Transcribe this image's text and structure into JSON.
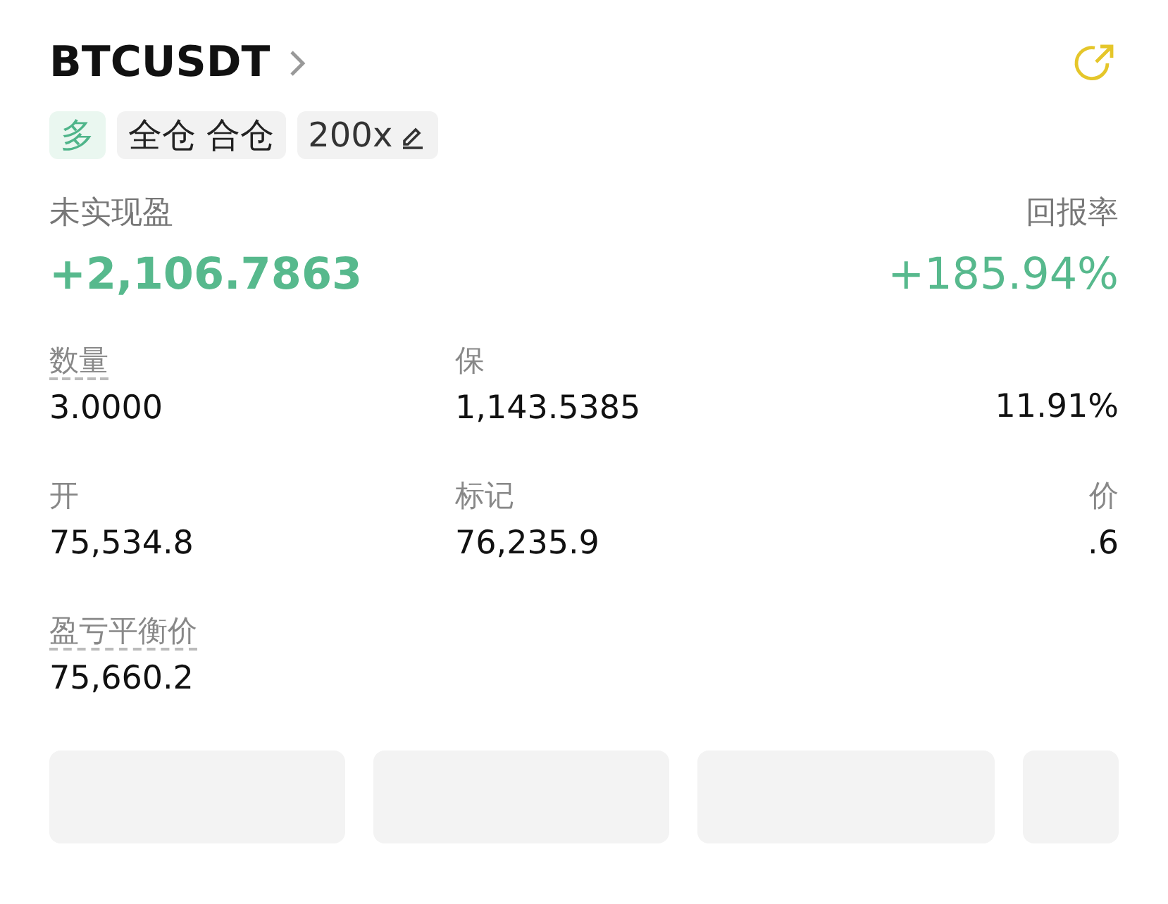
{
  "header": {
    "symbol": "BTCUSDT",
    "tags": [
      {
        "kind": "side",
        "label": "多"
      },
      {
        "kind": "mode",
        "label": "全仓 合仓"
      },
      {
        "kind": "leverage",
        "label": "200x"
      }
    ]
  },
  "pnl": {
    "label": "未实现盈",
    "value": "+2,106.7863",
    "roe_label": "回报率",
    "roe_value": "+185.94%"
  },
  "stats": [
    {
      "label": "数量",
      "value": "3.0000",
      "underlined": true
    },
    {
      "label": "保",
      "value": "1,143.5385",
      "underlined": false
    },
    {
      "value": "11.91%"
    },
    {
      "label": "开",
      "value": "75,534.8",
      "underlined": false
    },
    {
      "label": "标记",
      "value": "76,235.9",
      "underlined": false
    },
    {
      "label": "价",
      "value": ".6",
      "underlined": false
    },
    {
      "label": "盈亏平衡价",
      "value": "75,660.2",
      "underlined": true
    }
  ],
  "actions": [
    {
      "kind": "button"
    },
    {
      "kind": "button"
    },
    {
      "kind": "button"
    },
    {
      "kind": "button"
    }
  ]
}
